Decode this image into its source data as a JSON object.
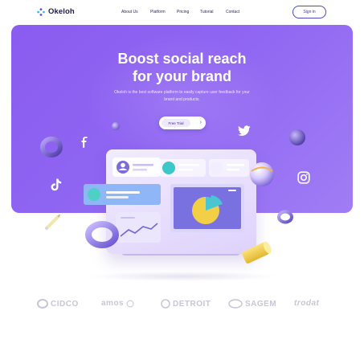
{
  "header": {
    "brand": "Okeloh",
    "nav": [
      "About Us",
      "Platform",
      "Pricing",
      "Tutorial",
      "Contact"
    ],
    "signin_label": "Sign in"
  },
  "hero": {
    "title_line1": "Boost social reach",
    "title_line2": "for your brand",
    "subtitle": "Okeloh is the best software platform to easily capture user feedback for your brand and products.",
    "cta_label": "Free Trial",
    "cta_arrow": "›"
  },
  "icons": [
    "facebook-icon",
    "twitter-icon",
    "tiktok-icon",
    "instagram-icon"
  ],
  "brands": [
    "CIDCO",
    "amos",
    "DETROIT",
    "SAGEM",
    "trodat"
  ],
  "colors": {
    "accent": "#8a5cf0",
    "cta_text": "#3a2f8a",
    "signin_border": "#4b49c8"
  }
}
